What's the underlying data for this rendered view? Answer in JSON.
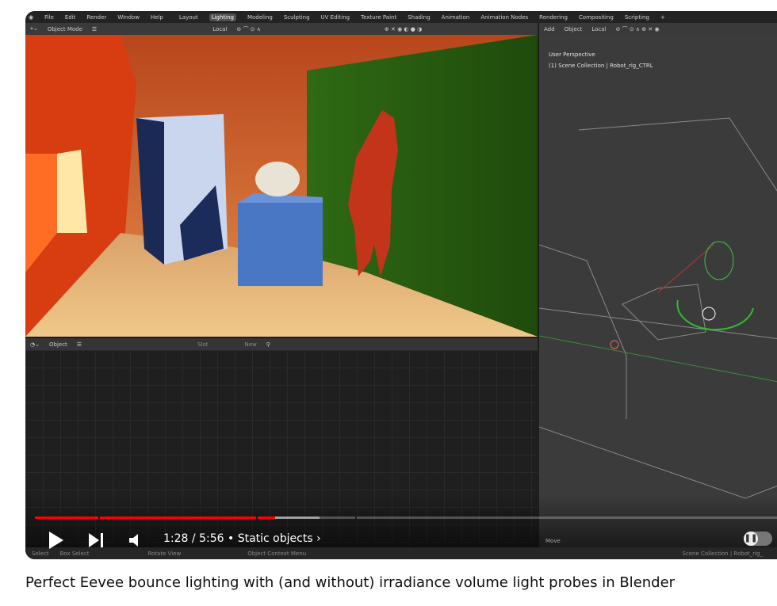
{
  "blender": {
    "menu": [
      "File",
      "Edit",
      "Render",
      "Window",
      "Help"
    ],
    "workspaces": [
      "Layout",
      "Lighting",
      "Modeling",
      "Sculpting",
      "UV Editing",
      "Texture Paint",
      "Shading",
      "Animation",
      "Animation Nodes",
      "Rendering",
      "Compositing",
      "Scripting",
      "+"
    ],
    "active_workspace": "Lighting",
    "left_header": {
      "mode": "Object Mode",
      "orientation": "Local"
    },
    "right_header": {
      "add": "Add",
      "object": "Object",
      "orientation": "Local"
    },
    "lower_header": {
      "mode": "Object",
      "slot": "Slot",
      "new": "New"
    },
    "viewport_overlay": {
      "perspective": "User Perspective",
      "collection": "(1) Scene Collection | Robot_rig_CTRL"
    },
    "last_op": "Move",
    "status": [
      "Select",
      "Box Select",
      "Rotate View",
      "Object Context Menu"
    ],
    "status_right": "Scene Collection | Robot_rig_"
  },
  "player": {
    "current_time": "1:28",
    "duration": "5:56",
    "separator": "/",
    "chapter": "Static objects",
    "progress_percent": 24.7,
    "buffered_percent": 29.3,
    "autoplay": "paused",
    "colors": {
      "progress": "#ff0000"
    }
  },
  "video_title": "Perfect Eevee bounce lighting with (and without) irradiance volume light probes in Blender"
}
